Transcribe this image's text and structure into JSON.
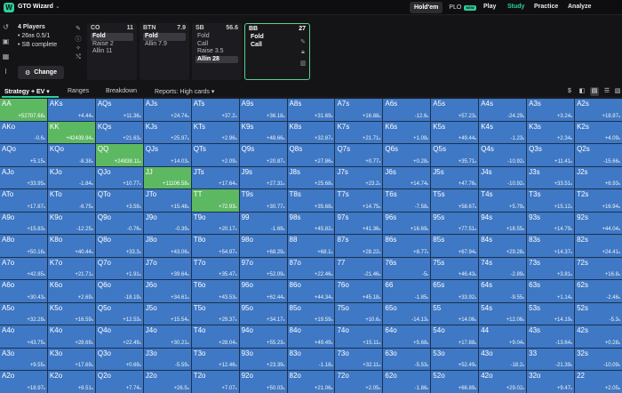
{
  "brand": {
    "name": "GTO Wizard"
  },
  "header": {
    "modes": [
      {
        "label": "Hold'em",
        "active": true
      },
      {
        "label": "PLO",
        "badge": "NEW",
        "active": false
      }
    ],
    "nav": [
      {
        "label": "Play",
        "active": false
      },
      {
        "label": "Study",
        "active": true
      },
      {
        "label": "Practice",
        "active": false
      },
      {
        "label": "Analyze",
        "active": false
      }
    ]
  },
  "game": {
    "players": "4 Players",
    "stack": "26",
    "stack_unit": "BB",
    "blinds": "0.5/1",
    "street": "SB complete",
    "change_label": "Change"
  },
  "positions": [
    {
      "name": "CO",
      "stack": "11",
      "actions": [
        {
          "label": "Fold",
          "selected": true
        },
        {
          "label": "Raise 2",
          "selected": false
        },
        {
          "label": "Allin 11",
          "selected": false
        }
      ]
    },
    {
      "name": "BTN",
      "stack": "7.9",
      "actions": [
        {
          "label": "Fold",
          "selected": true
        },
        {
          "label": "Allin 7.9",
          "selected": false
        }
      ]
    },
    {
      "name": "SB",
      "stack": "56.6",
      "actions": [
        {
          "label": "Fold",
          "selected": false
        },
        {
          "label": "Call",
          "selected": false
        },
        {
          "label": "Raise 3.5",
          "selected": false
        },
        {
          "label": "Allin 28",
          "selected": true
        }
      ]
    },
    {
      "name": "BB",
      "stack": "27",
      "actions": [
        {
          "label": "Fold",
          "selected": false
        },
        {
          "label": "Call",
          "selected": false
        }
      ]
    }
  ],
  "tabs": {
    "strategy": "Strategy + EV",
    "ranges": "Ranges",
    "breakdown": "Breakdown",
    "reports": "Reports: High cards"
  },
  "ev_unit": "s",
  "colors": {
    "call": "#5db862",
    "fold": "#3f78c4",
    "accent": "#2dcf9b"
  },
  "grid": [
    [
      [
        "AA",
        "+52707.68",
        "c"
      ],
      [
        "AKs",
        "+4.44",
        "f"
      ],
      [
        "AQs",
        "+11.36",
        "f"
      ],
      [
        "AJs",
        "+24.74",
        "f"
      ],
      [
        "ATs",
        "+37.2",
        "f"
      ],
      [
        "A9s",
        "+36.18",
        "f"
      ],
      [
        "A8s",
        "+31.69",
        "f"
      ],
      [
        "A7s",
        "+16.88",
        "f"
      ],
      [
        "A6s",
        "-12.6",
        "f"
      ],
      [
        "A5s",
        "+57.23",
        "f"
      ],
      [
        "A4s",
        "-24.29",
        "f"
      ],
      [
        "A3s",
        "+3.24",
        "f"
      ],
      [
        "A2s",
        "+18.97",
        "f"
      ]
    ],
    [
      [
        "AKo",
        "-0.6",
        "f"
      ],
      [
        "KK",
        "+42439.94",
        "c"
      ],
      [
        "KQs",
        "+21.63",
        "f"
      ],
      [
        "KJs",
        "+25.97",
        "f"
      ],
      [
        "KTs",
        "+2.96",
        "f"
      ],
      [
        "K9s",
        "+48.66",
        "f"
      ],
      [
        "K8s",
        "+32.87",
        "f"
      ],
      [
        "K7s",
        "+21.71",
        "f"
      ],
      [
        "K6s",
        "+1.08",
        "f"
      ],
      [
        "K5s",
        "+49.44",
        "f"
      ],
      [
        "K4s",
        "-1.23",
        "f"
      ],
      [
        "K3s",
        "+2.34",
        "f"
      ],
      [
        "K2s",
        "+4.09",
        "f"
      ]
    ],
    [
      [
        "AQo",
        "+5.15",
        "f"
      ],
      [
        "KQo",
        "-8.38",
        "f"
      ],
      [
        "QQ",
        "+24838.11",
        "c"
      ],
      [
        "QJs",
        "+14.03",
        "f"
      ],
      [
        "QTs",
        "+2.09",
        "f"
      ],
      [
        "Q9s",
        "+20.87",
        "f"
      ],
      [
        "Q8s",
        "+27.86",
        "f"
      ],
      [
        "Q7s",
        "+0.77",
        "f"
      ],
      [
        "Q6s",
        "+0.28",
        "f"
      ],
      [
        "Q5s",
        "+35.71",
        "f"
      ],
      [
        "Q4s",
        "-10.92",
        "f"
      ],
      [
        "Q3s",
        "+11.41",
        "f"
      ],
      [
        "Q2s",
        "-15.66",
        "f"
      ]
    ],
    [
      [
        "AJo",
        "+33.95",
        "f"
      ],
      [
        "KJo",
        "-1.84",
        "f"
      ],
      [
        "QJo",
        "+10.77",
        "f"
      ],
      [
        "JJ",
        "+11106.58",
        "c"
      ],
      [
        "JTs",
        "+17.64",
        "f"
      ],
      [
        "J9s",
        "+27.31",
        "f"
      ],
      [
        "J8s",
        "+25.68",
        "f"
      ],
      [
        "J7s",
        "+23.2",
        "f"
      ],
      [
        "J6s",
        "+14.74",
        "f"
      ],
      [
        "J5s",
        "+47.76",
        "f"
      ],
      [
        "J4s",
        "-10.92",
        "f"
      ],
      [
        "J3s",
        "+33.51",
        "f"
      ],
      [
        "J2s",
        "+6.93",
        "f"
      ]
    ],
    [
      [
        "ATo",
        "+17.87",
        "f"
      ],
      [
        "KTo",
        "-6.75",
        "f"
      ],
      [
        "QTo",
        "+3.59",
        "f"
      ],
      [
        "JTo",
        "+15.48",
        "f"
      ],
      [
        "TT",
        "+72.93",
        "c"
      ],
      [
        "T9s",
        "+30.77",
        "f"
      ],
      [
        "T8s",
        "+35.68",
        "f"
      ],
      [
        "T7s",
        "+14.75",
        "f"
      ],
      [
        "T6s",
        "-7.58",
        "f"
      ],
      [
        "T5s",
        "+58.67",
        "f"
      ],
      [
        "T4s",
        "+5.79",
        "f"
      ],
      [
        "T3s",
        "+15.12",
        "f"
      ],
      [
        "T2s",
        "+16.94",
        "f"
      ]
    ],
    [
      [
        "A9o",
        "+15.83",
        "f"
      ],
      [
        "K9o",
        "-12.25",
        "f"
      ],
      [
        "Q9o",
        "-0.76",
        "f"
      ],
      [
        "J9o",
        "-0.39",
        "f"
      ],
      [
        "T9o",
        "+20.17",
        "f"
      ],
      [
        "99",
        "-1.69",
        "f"
      ],
      [
        "98s",
        "+45.82",
        "f"
      ],
      [
        "97s",
        "+41.36",
        "f"
      ],
      [
        "96s",
        "+16.69",
        "f"
      ],
      [
        "95s",
        "+77.51",
        "f"
      ],
      [
        "94s",
        "+18.55",
        "f"
      ],
      [
        "93s",
        "+14.79",
        "f"
      ],
      [
        "92s",
        "+44.04",
        "f"
      ]
    ],
    [
      [
        "A8o",
        "+50.16",
        "f"
      ],
      [
        "K8o",
        "+40.44",
        "f"
      ],
      [
        "Q8o",
        "+33.3",
        "f"
      ],
      [
        "J8o",
        "+43.06",
        "f"
      ],
      [
        "T8o",
        "+54.97",
        "f"
      ],
      [
        "98o",
        "+68.29",
        "f"
      ],
      [
        "88",
        "+68.1",
        "f"
      ],
      [
        "87s",
        "+28.22",
        "f"
      ],
      [
        "86s",
        "+8.77",
        "f"
      ],
      [
        "85s",
        "+67.94",
        "f"
      ],
      [
        "84s",
        "+29.28",
        "f"
      ],
      [
        "83s",
        "+14.37",
        "f"
      ],
      [
        "82s",
        "+24.41",
        "f"
      ]
    ],
    [
      [
        "A7o",
        "+42.85",
        "f"
      ],
      [
        "K7o",
        "+21.71",
        "f"
      ],
      [
        "Q7o",
        "+1.91",
        "f"
      ],
      [
        "J7o",
        "+39.64",
        "f"
      ],
      [
        "T7o",
        "+35.47",
        "f"
      ],
      [
        "97o",
        "+52.09",
        "f"
      ],
      [
        "87o",
        "+22.46",
        "f"
      ],
      [
        "77",
        "-21.46",
        "f"
      ],
      [
        "76s",
        "-5",
        "f"
      ],
      [
        "75s",
        "+46.43",
        "f"
      ],
      [
        "74s",
        "-2.89",
        "f"
      ],
      [
        "73s",
        "+3.81",
        "f"
      ],
      [
        "72s",
        "+16.8",
        "f"
      ]
    ],
    [
      [
        "A6o",
        "+30.43",
        "f"
      ],
      [
        "K6o",
        "+2.69",
        "f"
      ],
      [
        "Q6o",
        "-18.19",
        "f"
      ],
      [
        "J6o",
        "+34.61",
        "f"
      ],
      [
        "T6o",
        "+43.53",
        "f"
      ],
      [
        "96o",
        "+62.44",
        "f"
      ],
      [
        "86o",
        "+44.34",
        "f"
      ],
      [
        "76o",
        "+45.18",
        "f"
      ],
      [
        "66",
        "-1.85",
        "f"
      ],
      [
        "65s",
        "+33.92",
        "f"
      ],
      [
        "64s",
        "-9.55",
        "f"
      ],
      [
        "63s",
        "+1.14",
        "f"
      ],
      [
        "62s",
        "-2.46",
        "f"
      ]
    ],
    [
      [
        "A5o",
        "+32.28",
        "f"
      ],
      [
        "K5o",
        "+16.59",
        "f"
      ],
      [
        "Q5o",
        "+12.53",
        "f"
      ],
      [
        "J5o",
        "+15.54",
        "f"
      ],
      [
        "T5o",
        "+29.37",
        "f"
      ],
      [
        "95o",
        "+34.17",
        "f"
      ],
      [
        "85o",
        "+19.59",
        "f"
      ],
      [
        "75o",
        "+10.6",
        "f"
      ],
      [
        "65o",
        "-14.13",
        "f"
      ],
      [
        "55",
        "+14.06",
        "f"
      ],
      [
        "54s",
        "+12.06",
        "f"
      ],
      [
        "53s",
        "+14.19",
        "f"
      ],
      [
        "52s",
        "-5.3",
        "f"
      ]
    ],
    [
      [
        "A4o",
        "+43.75",
        "f"
      ],
      [
        "K4o",
        "+28.69",
        "f"
      ],
      [
        "Q4o",
        "+22.49",
        "f"
      ],
      [
        "J4o",
        "+30.21",
        "f"
      ],
      [
        "T4o",
        "+28.04",
        "f"
      ],
      [
        "94o",
        "+55.23",
        "f"
      ],
      [
        "84o",
        "+49.49",
        "f"
      ],
      [
        "74o",
        "+15.11",
        "f"
      ],
      [
        "64o",
        "+5.68",
        "f"
      ],
      [
        "54o",
        "+17.88",
        "f"
      ],
      [
        "44",
        "+9.04",
        "f"
      ],
      [
        "43s",
        "-13.64",
        "f"
      ],
      [
        "42s",
        "+0.28",
        "f"
      ]
    ],
    [
      [
        "A3o",
        "+9.55",
        "f"
      ],
      [
        "K3o",
        "+17.69",
        "f"
      ],
      [
        "Q3o",
        "+0.69",
        "f"
      ],
      [
        "J3o",
        "-5.59",
        "f"
      ],
      [
        "T3o",
        "+12.46",
        "f"
      ],
      [
        "93o",
        "+23.39",
        "f"
      ],
      [
        "83o",
        "-1.18",
        "f"
      ],
      [
        "73o",
        "+32.11",
        "f"
      ],
      [
        "63o",
        "-5.53",
        "f"
      ],
      [
        "53o",
        "+52.49",
        "f"
      ],
      [
        "43o",
        "-18.2",
        "f"
      ],
      [
        "33",
        "-21.39",
        "f"
      ],
      [
        "32s",
        "-10.09",
        "f"
      ]
    ],
    [
      [
        "A2o",
        "+18.97",
        "f"
      ],
      [
        "K2o",
        "+8.51",
        "f"
      ],
      [
        "Q2o",
        "+7.74",
        "f"
      ],
      [
        "J2o",
        "+26.5",
        "f"
      ],
      [
        "T2o",
        "+7.07",
        "f"
      ],
      [
        "92o",
        "+50.03",
        "f"
      ],
      [
        "82o",
        "+21.06",
        "f"
      ],
      [
        "72o",
        "+2.05",
        "f"
      ],
      [
        "62o",
        "-1.86",
        "f"
      ],
      [
        "52o",
        "+66.89",
        "f"
      ],
      [
        "42o",
        "+29.02",
        "f"
      ],
      [
        "32o",
        "+9.47",
        "f"
      ],
      [
        "22",
        "+2.05",
        "f"
      ]
    ]
  ]
}
